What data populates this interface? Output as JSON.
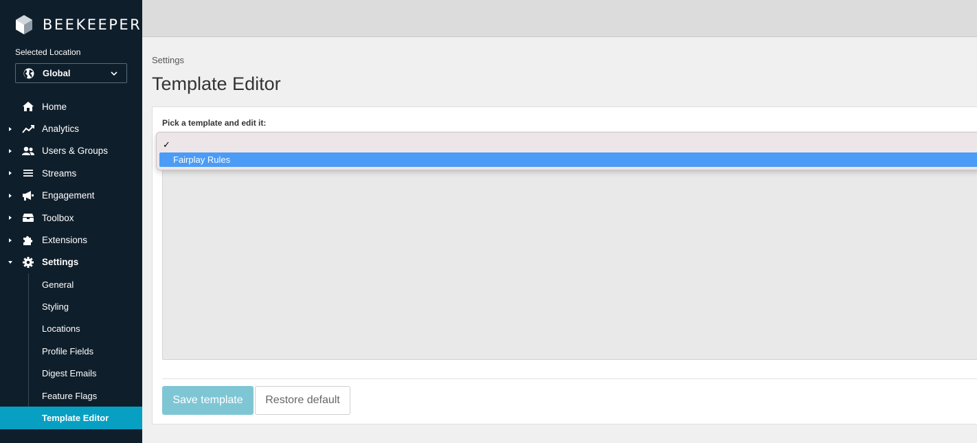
{
  "brand": {
    "name": "BEEKEEPER"
  },
  "location": {
    "label": "Selected Location",
    "value": "Global"
  },
  "nav": [
    {
      "label": "Home",
      "icon": "home-icon",
      "expandable": false
    },
    {
      "label": "Analytics",
      "icon": "analytics-icon",
      "expandable": true
    },
    {
      "label": "Users & Groups",
      "icon": "users-icon",
      "expandable": true
    },
    {
      "label": "Streams",
      "icon": "streams-icon",
      "expandable": true
    },
    {
      "label": "Engagement",
      "icon": "megaphone-icon",
      "expandable": true
    },
    {
      "label": "Toolbox",
      "icon": "toolbox-icon",
      "expandable": true
    },
    {
      "label": "Extensions",
      "icon": "puzzle-icon",
      "expandable": true
    },
    {
      "label": "Settings",
      "icon": "gear-icon",
      "expandable": true,
      "expanded": true
    }
  ],
  "settings_sub": [
    {
      "label": "General"
    },
    {
      "label": "Styling"
    },
    {
      "label": "Locations"
    },
    {
      "label": "Profile Fields"
    },
    {
      "label": "Digest Emails"
    },
    {
      "label": "Feature Flags"
    },
    {
      "label": "Template Editor",
      "active": true
    }
  ],
  "breadcrumb": "Settings",
  "page_title": "Template Editor",
  "form": {
    "pick_label": "Pick a template and edit it:",
    "options": [
      {
        "label": "",
        "checked": true
      },
      {
        "label": "Fairplay Rules",
        "highlighted": true
      }
    ]
  },
  "buttons": {
    "save": "Save template",
    "restore": "Restore default"
  },
  "colors": {
    "sidebar": "#0f1e2b",
    "accent": "#07a0c3",
    "highlight": "#4a9cf7",
    "save_disabled": "#7fc6d5"
  }
}
